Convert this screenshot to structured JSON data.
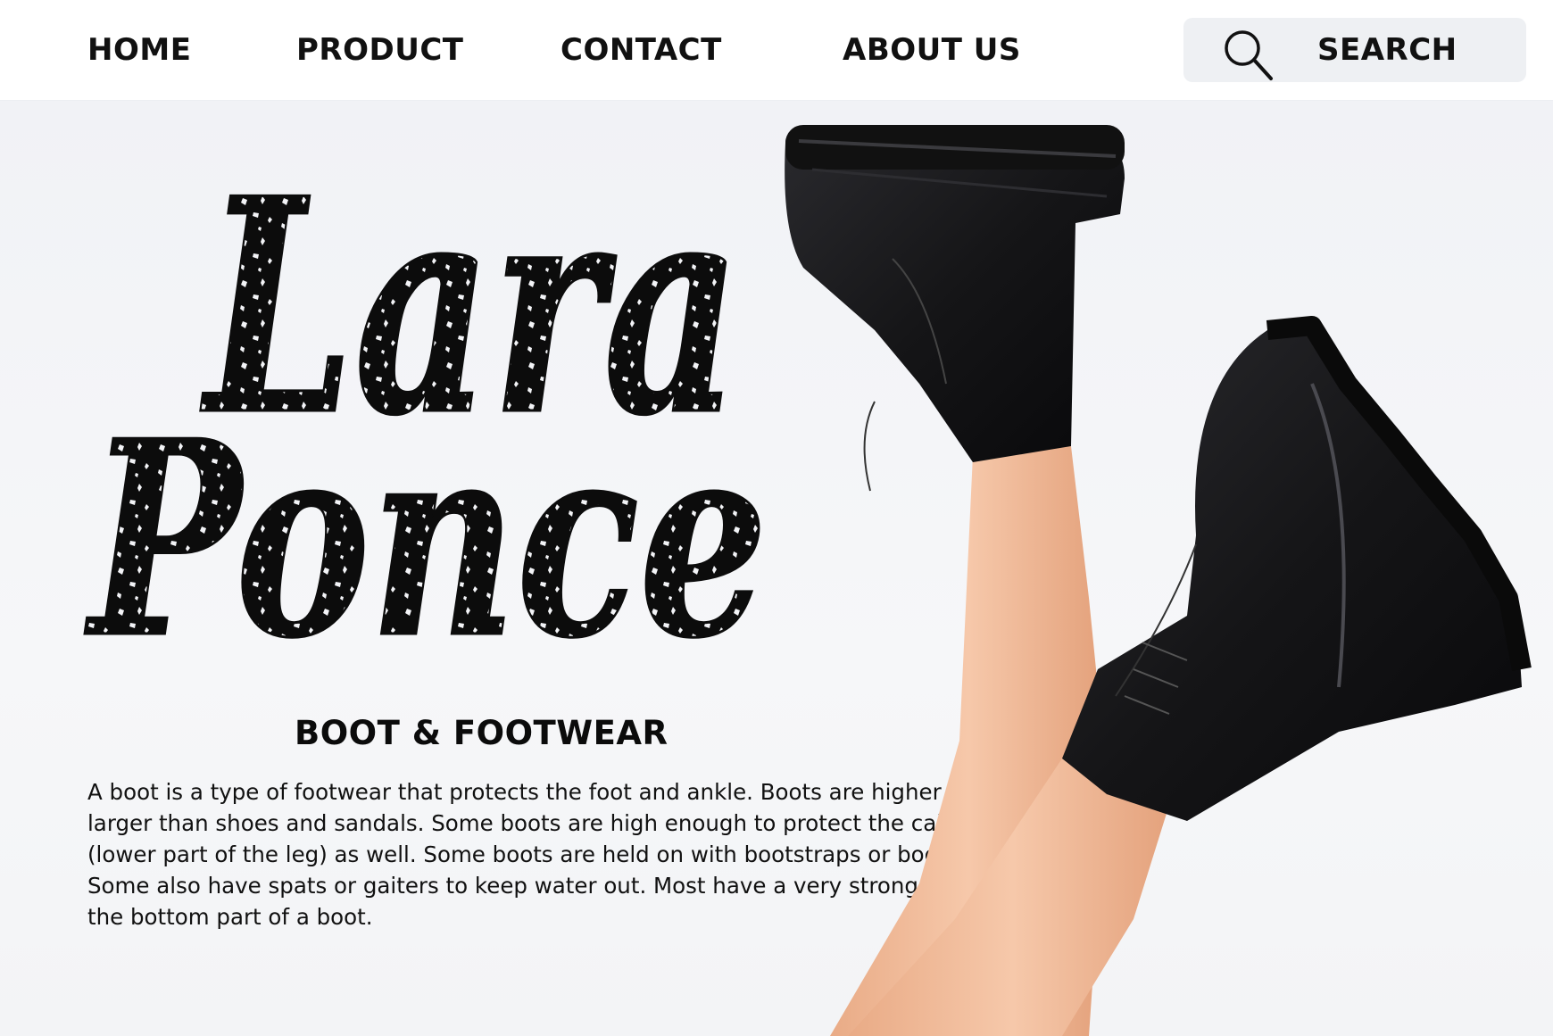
{
  "nav": {
    "items": [
      {
        "label": "HOME"
      },
      {
        "label": "PRODUCT"
      },
      {
        "label": "CONTACT"
      },
      {
        "label": "ABOUT US"
      }
    ]
  },
  "search": {
    "label": "SEARCH",
    "icon": "search-icon"
  },
  "hero": {
    "brand_line1": "Lara",
    "brand_line2": "Ponce",
    "subtitle": "BOOT & FOOTWEAR",
    "description": "A boot is a type of footwear that protects the foot and ankle. Boots are higher and larger than shoes and sandals. Some boots are high enough to protect the calves (lower part of the leg) as well. Some boots are held on with bootstraps or bootlaces. Some also have spats or gaiters to keep water out. Most have a very strong boot sole, the bottom part of a boot.",
    "image": "legs-wearing-black-combat-boots"
  },
  "colors": {
    "text": "#111111",
    "background": "#f3f4f7",
    "boot": "#141416",
    "skin": "#f0bc9c"
  }
}
